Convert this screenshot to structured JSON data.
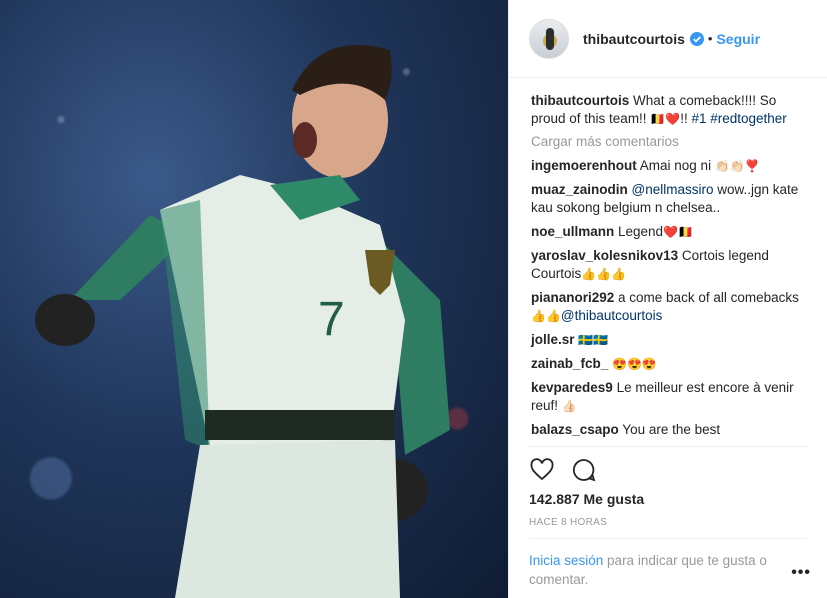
{
  "post": {
    "username": "thibautcourtois",
    "follow_label": "Seguir",
    "separator": "•",
    "caption": {
      "user": "thibautcourtois",
      "text_1": " What a comeback!!!! So proud of this team!! ",
      "emoji": "🇧🇪❤️",
      "text_2": "!! ",
      "mention": "#1 #redtogether"
    },
    "load_more": "Cargar más comentarios",
    "comments": [
      {
        "user": "ingemoerenhout",
        "text": " Amai nog ni ",
        "emoji": "👏🏻👏🏻❣️"
      },
      {
        "user": "muaz_zainodin",
        "mention": "@nellmassiro",
        "text": " wow..jgn kate kau sokong belgium n chelsea.."
      },
      {
        "user": "noe_ullmann",
        "text": " Legend",
        "emoji": "❤️🇧🇪"
      },
      {
        "user": "yaroslav_kolesnikov13",
        "text": " Cortois legend Courtois",
        "emoji": "👍👍👍"
      },
      {
        "user": "piananori292",
        "text": " a come back of all comebacks ",
        "emoji": "👍👍",
        "mention": "@thibautcourtois"
      },
      {
        "user": "jolle.sr",
        "text": " ",
        "emoji": "🇸🇪🇸🇪"
      },
      {
        "user": "zainab_fcb_",
        "text": " ",
        "emoji": "😍😍😍"
      },
      {
        "user": "kevparedes9",
        "text": " Le meilleur est encore à venir reuf! ",
        "emoji": "👍🏻"
      },
      {
        "user": "balazs_csapo",
        "text": " You are the best"
      }
    ],
    "likes": "142.887 Me gusta",
    "time": "HACE 8 HORAS",
    "login_link": "Inicia sesión",
    "login_text": " para indicar que te gusta o comentar.",
    "more_icon": "•••",
    "icons": [
      "heart-icon",
      "comment-icon",
      "verified-icon",
      "more-options-icon"
    ],
    "jersey_number": "7",
    "colors": {
      "accent": "#3897f0",
      "jersey": "#e8efe9",
      "sleeves": "#2f8a6a"
    }
  }
}
